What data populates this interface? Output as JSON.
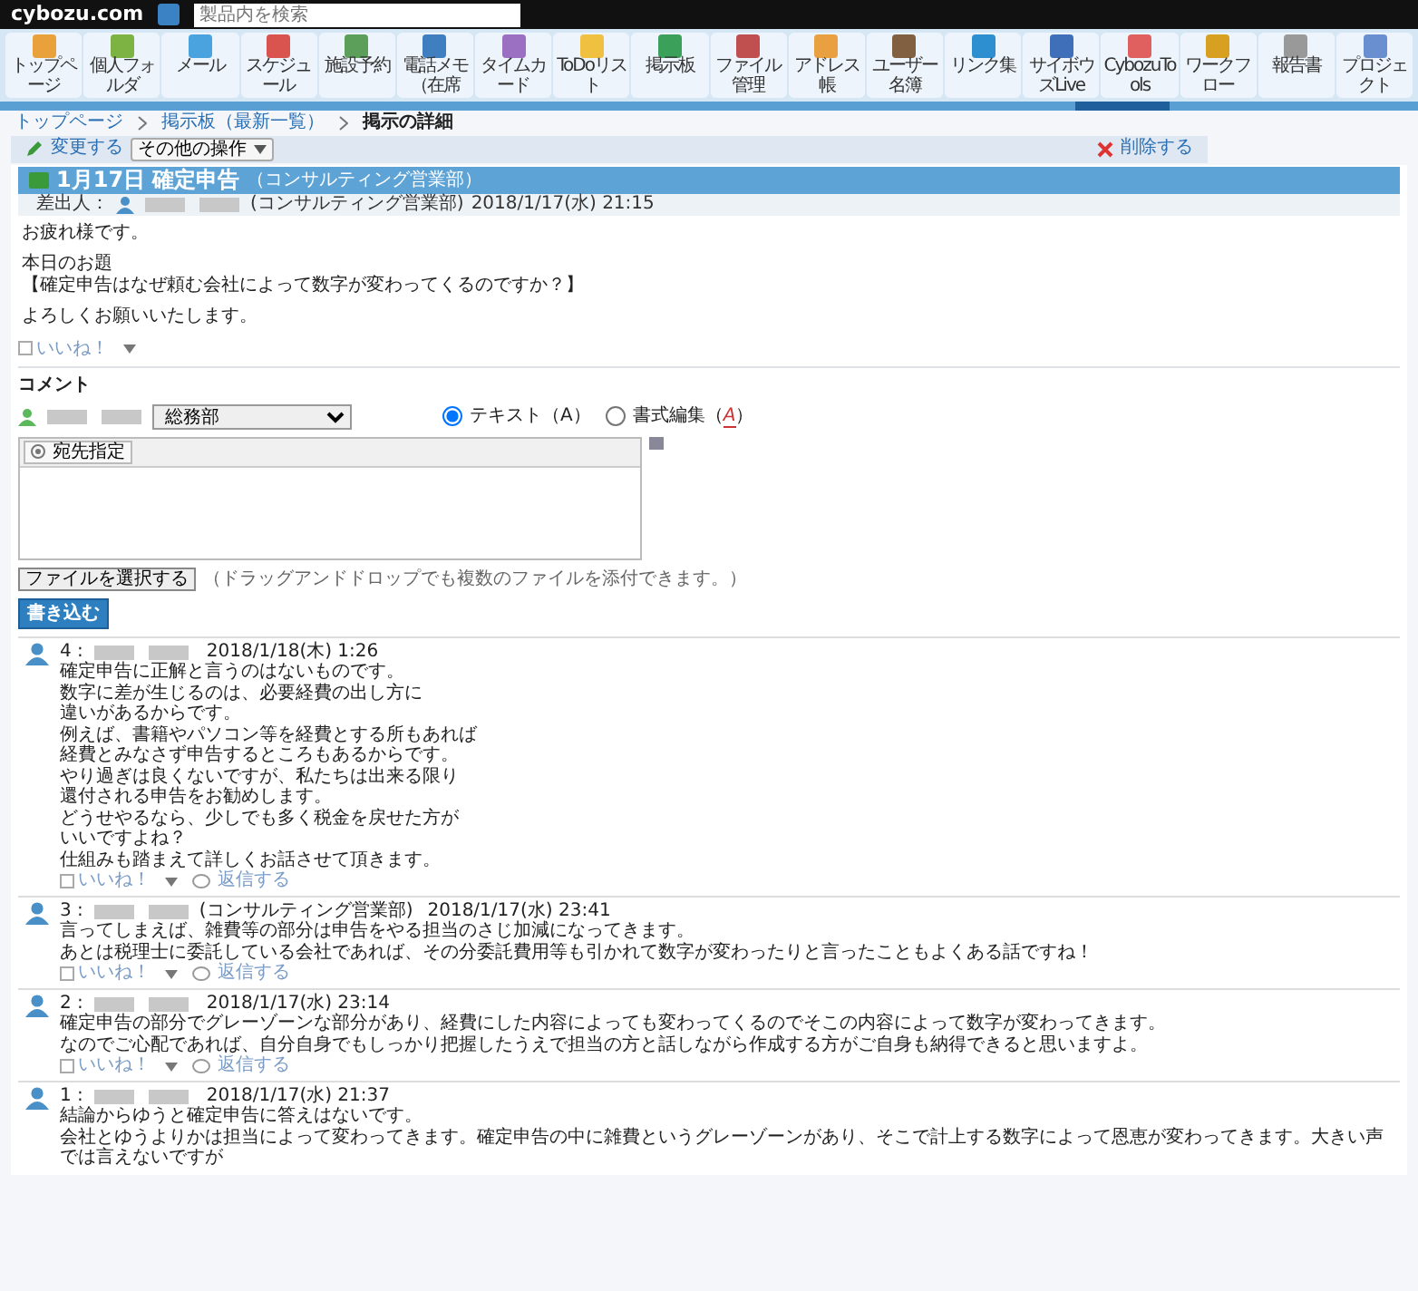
{
  "top_bar": {
    "logo": "cybozu.com",
    "search": {
      "placeholder": "製品内を検索"
    }
  },
  "apps": [
    {
      "label": "トップページ"
    },
    {
      "label": "個人フォルダ"
    },
    {
      "label": "メール"
    },
    {
      "label": "スケジュール"
    },
    {
      "label": "施設予約"
    },
    {
      "label": "電話メモ（在席"
    },
    {
      "label": "タイムカード"
    },
    {
      "label": "ToDoリスト"
    },
    {
      "label": "掲示板"
    },
    {
      "label": "ファイル管理"
    },
    {
      "label": "アドレス帳"
    },
    {
      "label": "ユーザー名簿"
    },
    {
      "label": "リンク集"
    },
    {
      "label": "サイボウズLive"
    },
    {
      "label": "CybozuTools"
    },
    {
      "label": "ワークフロー"
    },
    {
      "label": "報告書"
    },
    {
      "label": "プロジェクト"
    }
  ],
  "breadcrumb": [
    "トップページ",
    "掲示板（最新一覧）",
    "掲示の詳細"
  ],
  "actions": {
    "edit": "変更する",
    "more": "その他の操作",
    "delete": "削除する"
  },
  "topic": {
    "title": "1月17日 確定申告",
    "department": "（コンサルティング営業部）",
    "sender_label": "差出人：",
    "sender_department": "(コンサルティング営業部)",
    "datetime": "2018/1/17(水) 21:15",
    "paragraphs": [
      [
        "お疲れ様です。"
      ],
      [
        "本日のお題",
        "【確定申告はなぜ頼む会社によって数字が変わってくるのですか？】"
      ],
      [
        "よろしくお願いいたします。"
      ]
    ],
    "like": "いいね！"
  },
  "comment_form": {
    "heading": "コメント",
    "department": "総務部",
    "formats": [
      {
        "label": "テキスト（A）",
        "selected": true
      },
      {
        "label": "書式編集（",
        "accent": "A",
        "closing": "）",
        "selected": false
      }
    ],
    "recipient_button": "宛先指定",
    "file_button": "ファイルを選択する",
    "file_hint": "（ドラッグアンドドロップでも複数のファイルを添付できます。）",
    "submit": "書き込む"
  },
  "comments": [
    {
      "number": "4 :",
      "datetime": "2018/1/18(木) 1:26",
      "lines": [
        "確定申告に正解と言うのはないものです。",
        "数字に差が生じるのは、必要経費の出し方に",
        "違いがあるからです。",
        "例えば、書籍やパソコン等を経費とする所もあれば",
        "経費とみなさず申告するところもあるからです。",
        "やり過ぎは良くないですが、私たちは出来る限り",
        "還付される申告をお勧めします。",
        "どうせやるなら、少しでも多く税金を戻せた方が",
        "いいですよね？",
        "仕組みも踏まえて詳しくお話させて頂きます。"
      ],
      "like": "いいね！",
      "reply": "返信する"
    },
    {
      "number": "3 :",
      "department": "(コンサルティング営業部)",
      "datetime": "2018/1/17(水) 23:41",
      "lines": [
        "言ってしまえば、雑費等の部分は申告をやる担当のさじ加減になってきます。",
        "あとは税理士に委託している会社であれば、その分委託費用等も引かれて数字が変わったりと言ったこともよくある話ですね！"
      ],
      "like": "いいね！",
      "reply": "返信する"
    },
    {
      "number": "2 :",
      "datetime": "2018/1/17(水) 23:14",
      "lines": [
        "確定申告の部分でグレーゾーンな部分があり、経費にした内容によっても変わってくるのでそこの内容によって数字が変わってきます。",
        "なのでご心配であれば、自分自身でもしっかり把握したうえで担当の方と話しながら作成する方がご自身も納得できると思いますよ。"
      ],
      "like": "いいね！",
      "reply": "返信する"
    },
    {
      "number": "1 :",
      "datetime": "2018/1/17(水) 21:37",
      "lines": [
        "結論からゆうと確定申告に答えはないです。",
        "会社とゆうよりかは担当によって変わってきます。確定申告の中に雑費というグレーゾーンがあり、そこで計上する数字によって恩恵が変わってきます。大きい声では言えないですが"
      ]
    }
  ]
}
